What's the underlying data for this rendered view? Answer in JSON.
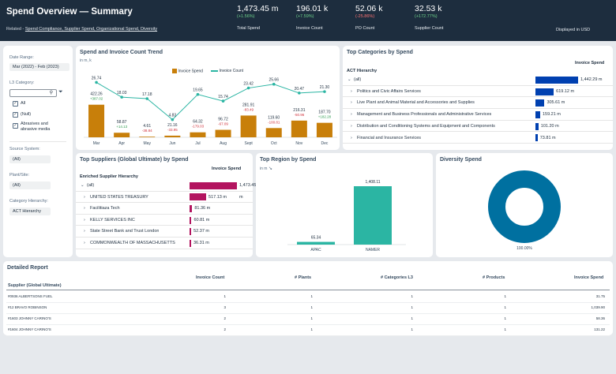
{
  "header": {
    "title": "Spend Overview — Summary",
    "related_prefix": "Related - ",
    "related_links": "Spend Compliance, Supplier Spend, Organizational Spend, Diversity",
    "displayed_in": "Displayed in USD",
    "kpis": [
      {
        "value": "1,473.45 m",
        "delta": "(+1.56%)",
        "negative": false,
        "label": "Total Spend"
      },
      {
        "value": "196.01 k",
        "delta": "(+7.59%)",
        "negative": false,
        "label": "Invoice Count"
      },
      {
        "value": "52.06 k",
        "delta": "(-25.86%)",
        "negative": true,
        "label": "PO Count"
      },
      {
        "value": "32.53 k",
        "delta": "(+172.77%)",
        "negative": false,
        "label": "Supplier Count"
      }
    ]
  },
  "filters": {
    "date_range_label": "Date Range:",
    "date_range_value": "Mar (2022) - Feb (2023)",
    "l3_label": "L3 Category:",
    "l3_options": [
      {
        "label": "All",
        "checked": true
      },
      {
        "label": "(Null)",
        "checked": true
      },
      {
        "label": "Abrasives and abrasive media",
        "checked": true
      }
    ],
    "source_label": "Source System:",
    "source_value": "(All)",
    "plant_label": "Plant/Site:",
    "plant_value": "(All)",
    "hierarchy_label": "Category Hierarchy:",
    "hierarchy_value": "ACT Hierarchy"
  },
  "spend_trend": {
    "title": "Spend and Invoice Count Trend",
    "unit": "in m, k",
    "legend_spend": "Invoice Spend",
    "legend_count": "Invoice Count",
    "colors": {
      "bar": "#c87f0a",
      "line": "#2bb5a3"
    },
    "chart_data": {
      "type": "bar",
      "categories": [
        "Mar",
        "Apr",
        "May",
        "Jun",
        "Jul",
        "Aug",
        "Sept",
        "Oct",
        "Nov",
        "Dec"
      ],
      "series": [
        {
          "name": "Invoice Spend",
          "values": [
            422.26,
            58.87,
            4.61,
            21.16,
            64.32,
            96.72,
            281.91,
            119.6,
            216.31,
            187.7
          ],
          "labels": [
            "422.26",
            "58.87",
            "4.61",
            "21.16",
            "64.32",
            "96.72",
            "281.91",
            "119.60",
            "216.31",
            "187.70"
          ],
          "deltas": [
            "+387.02",
            "+14.13",
            "-38.84",
            "-33.95",
            "-179.03",
            "-67.09",
            "-83.49",
            "-100.81",
            "-50.96",
            "+182.28"
          ]
        },
        {
          "name": "Invoice Count",
          "values": [
            26.74,
            18.03,
            17.18,
            4.83,
            19.65,
            15.74,
            23.42,
            25.66,
            20.47,
            21.3
          ],
          "labels": [
            "26.74",
            "18.03",
            "17.18",
            "4.83",
            "19.65",
            "15.74",
            "23.42",
            "25.66",
            "20.47",
            "21.30"
          ]
        }
      ]
    }
  },
  "top_categories": {
    "title": "Top Categories by Spend",
    "col_header": "Invoice Spend",
    "hier_header": "ACT Hierarchy",
    "color": "#0040b0",
    "rows": [
      {
        "label": "(all)",
        "value": 1442.29,
        "value_label": "1,442.29 m"
      },
      {
        "label": "Politics and Civic Affairs Services",
        "value": 619.12,
        "value_label": "619.12 m"
      },
      {
        "label": "Live Plant and Animal Material and Accessories and Supplies",
        "value": 305.61,
        "value_label": "305.61 m"
      },
      {
        "label": "Management and Business Professionals and Administrative Services",
        "value": 159.21,
        "value_label": "159.21 m"
      },
      {
        "label": "Distribution and Conditioning Systems and Equipment and Components",
        "value": 101.2,
        "value_label": "101.20 m"
      },
      {
        "label": "Financial and Insurance Services",
        "value": 73.81,
        "value_label": "73.81 m"
      }
    ]
  },
  "top_suppliers": {
    "title": "Top Suppliers (Global Ultimate) by Spend",
    "col_header": "Invoice Spend",
    "hier_header": "Enriched Supplier Hierarchy",
    "color": "#b3145f",
    "rows": [
      {
        "label": "(all)",
        "value": 1473.45,
        "value_label": "1,473.45 m"
      },
      {
        "label": "UNITED STATES TREASURY",
        "value": 517.13,
        "value_label": "517.13 m"
      },
      {
        "label": "Facilitiaza Tech",
        "value": 81.36,
        "value_label": "81.36 m"
      },
      {
        "label": "KELLY SERVICES INC",
        "value": 60.81,
        "value_label": "60.81 m"
      },
      {
        "label": "State Street Bank and Trust London",
        "value": 52.37,
        "value_label": "52.37 m"
      },
      {
        "label": "COMMONWEALTH OF MASSACHUSETTS",
        "value": 36.31,
        "value_label": "36.31 m"
      }
    ]
  },
  "top_region": {
    "title": "Top Region by Spend",
    "unit": "in m",
    "color": "#2bb5a3",
    "chart_data": {
      "type": "bar",
      "categories": [
        "APAC",
        "NAMER"
      ],
      "values": [
        65.34,
        1408.11
      ],
      "labels": [
        "65.34",
        "1,408.11"
      ]
    }
  },
  "diversity": {
    "title": "Diversity Spend",
    "color": "#0070a0",
    "chart_data": {
      "type": "pie",
      "values": [
        100
      ],
      "labels": [
        "100.00%"
      ]
    }
  },
  "report": {
    "title": "Detailed Report",
    "columns": [
      "Supplier (Global Ultimate)",
      "Invoice Count",
      "# Plants",
      "# Categories L3",
      "# Products",
      "Invoice Spend"
    ],
    "rows": [
      [
        "#0936 ALBERTSONS FUEL",
        "1",
        "1",
        "1",
        "1",
        "31.75"
      ],
      [
        "#12 BRAVO ROBINSON",
        "3",
        "1",
        "1",
        "1",
        "1,039.90"
      ],
      [
        "#1603 JOHNNY CARINO'S",
        "2",
        "1",
        "1",
        "1",
        "58.36"
      ],
      [
        "#1604 JOHNNY CARINO'S",
        "2",
        "1",
        "1",
        "1",
        "131.22"
      ]
    ]
  }
}
